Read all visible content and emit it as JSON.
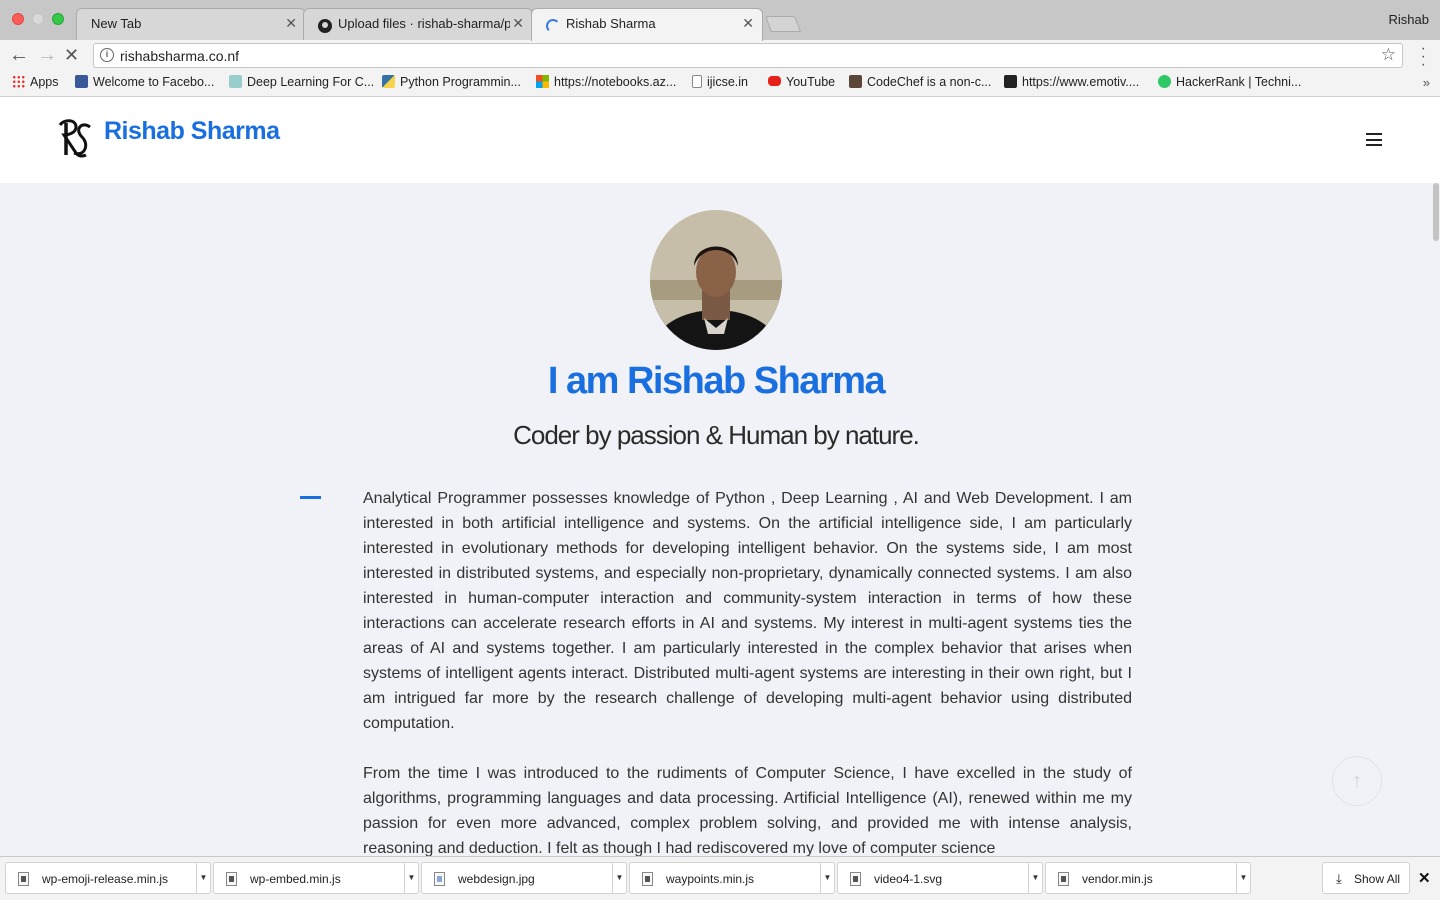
{
  "browser": {
    "profile_name": "Rishab",
    "tabs": [
      {
        "title": "New Tab",
        "close": "✕"
      },
      {
        "title": "Upload files · rishab-sharma/p",
        "close": "✕"
      },
      {
        "title": "Rishab Sharma",
        "close": "✕"
      }
    ],
    "url": "rishabsharma.co.nf",
    "bookmarks": [
      {
        "label": "Apps",
        "icon": "apps-grid-icon"
      },
      {
        "label": "Welcome to Facebo...",
        "icon": "facebook-icon"
      },
      {
        "label": "Deep Learning For C...",
        "icon": "bookmark-icon"
      },
      {
        "label": "Python Programmin...",
        "icon": "python-icon"
      },
      {
        "label": "https://notebooks.az...",
        "icon": "microsoft-icon"
      },
      {
        "label": "ijicse.in",
        "icon": "page-icon"
      },
      {
        "label": "YouTube",
        "icon": "youtube-icon"
      },
      {
        "label": "CodeChef is a non-c...",
        "icon": "codechef-icon"
      },
      {
        "label": "https://www.emotiv....",
        "icon": "emotiv-icon"
      },
      {
        "label": "HackerRank | Techni...",
        "icon": "hackerrank-icon"
      }
    ]
  },
  "site": {
    "logo_text": "Rishab Sharma",
    "hero_title": "I am Rishab Sharma",
    "hero_subtitle": "Coder by passion & Human by nature.",
    "paragraph_1": "Analytical Programmer possesses knowledge of Python , Deep Learning , AI and Web Development. I am interested in both artificial intelligence and systems. On the artificial intelligence side, I am particularly interested in evolutionary methods for developing intelligent behavior. On the systems side, I am most interested in distributed systems, and especially non-proprietary, dynamically connected systems. I am also interested in human-computer interaction and community-system interaction in terms of how these interactions can accelerate research efforts in AI and systems. My interest in multi-agent systems ties the areas of AI and systems together. I am particularly interested in the complex behavior that arises when systems of intelligent agents interact. Distributed multi-agent systems are interesting in their own right, but I am intrigued far more by the research challenge of developing multi-agent behavior using distributed computation.",
    "paragraph_2": "From the time I was introduced to the rudiments of Computer Science, I have excelled in the study of algorithms, programming languages and data processing. Artificial Intelligence (AI), renewed within me my passion for even more advanced, complex problem solving, and provided me with intense analysis, reasoning and deduction. I felt as though I had rediscovered my love of computer science"
  },
  "downloads": {
    "items": [
      {
        "name": "wp-emoji-release.min.js"
      },
      {
        "name": "wp-embed.min.js"
      },
      {
        "name": "webdesign.jpg"
      },
      {
        "name": "waypoints.min.js"
      },
      {
        "name": "video4-1.svg"
      },
      {
        "name": "vendor.min.js"
      }
    ],
    "show_all": "Show All"
  },
  "colors": {
    "accent": "#1a6fe0",
    "page_bg": "#f1f2f7"
  }
}
